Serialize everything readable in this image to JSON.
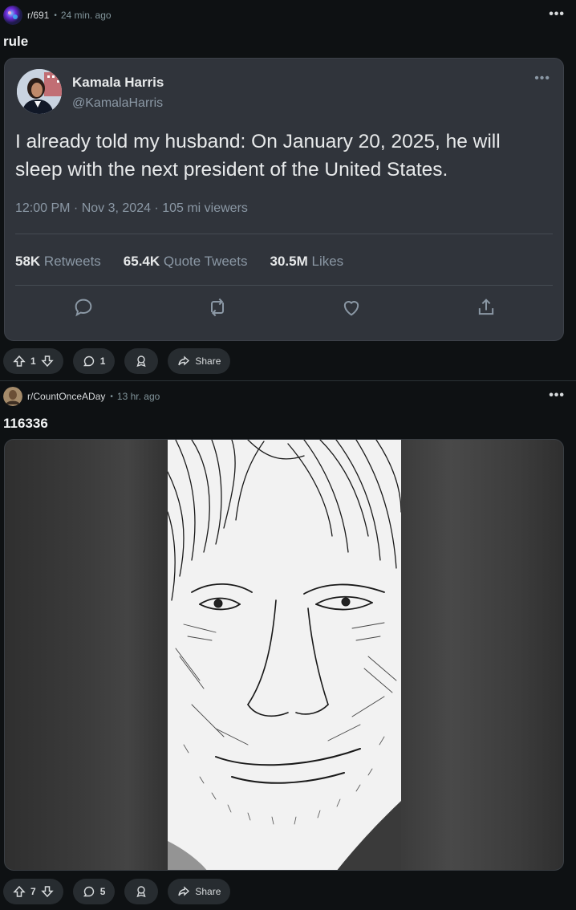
{
  "post1": {
    "subreddit": "r/691",
    "time": "24 min. ago",
    "title": "rule",
    "more": "•••",
    "tweet": {
      "name": "Kamala Harris",
      "handle": "@KamalaHarris",
      "more": "•••",
      "text": "I already told my husband: On January 20, 2025, he will sleep with the next president of the United States.",
      "datetime": "12:00 PM · Nov 3, 2024 · 105 mi viewers",
      "retweets_count": "58K",
      "retweets_label": "Retweets",
      "quotes_count": "65.4K",
      "quotes_label": "Quote Tweets",
      "likes_count": "30.5M",
      "likes_label": "Likes"
    },
    "votes": "1",
    "comments": "1",
    "share_label": "Share"
  },
  "post2": {
    "subreddit": "r/CountOnceADay",
    "time": "13 hr. ago",
    "title": "116336",
    "more": "•••",
    "votes": "7",
    "comments": "5",
    "share_label": "Share"
  },
  "colors": {
    "background": "#0e1113",
    "card": "#30343b",
    "pill": "#272c30",
    "muted": "#8b98a5"
  }
}
